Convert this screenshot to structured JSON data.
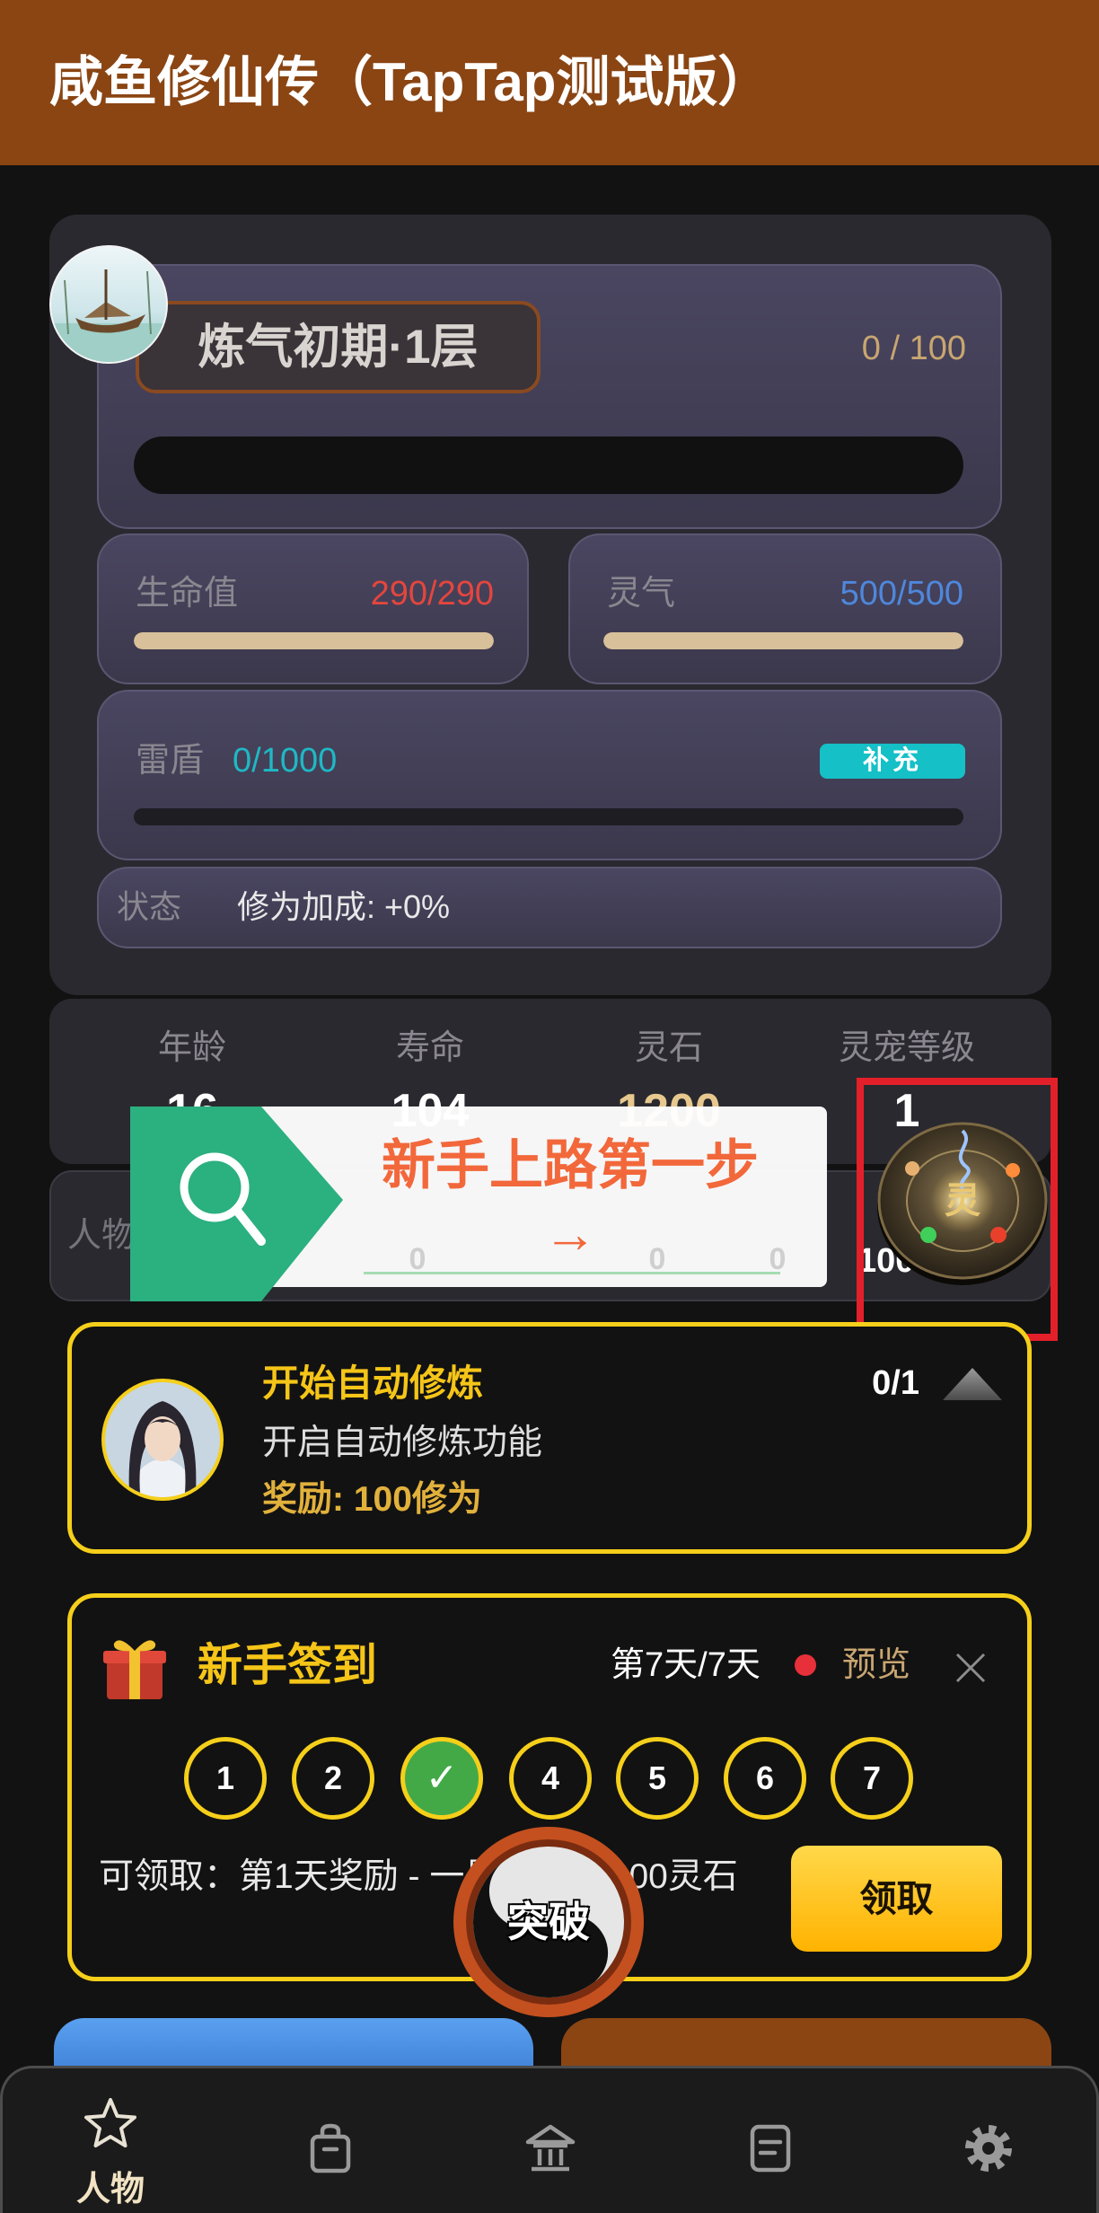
{
  "app": {
    "title": "咸鱼修仙传（TapTap测试版）"
  },
  "colors": {
    "header": "#8a4513",
    "accent": "#f5cf1a",
    "hp": "#e4463e",
    "qi": "#4f87db",
    "shield": "#1fb8c5",
    "tutorial": "#f2683b",
    "highlight": "#e3202a"
  },
  "realm": {
    "name": "炼气初期·1层",
    "progress_text": "0 / 100",
    "progress": 0
  },
  "hp": {
    "label": "生命值",
    "value": "290/290",
    "fill": 1
  },
  "qi": {
    "label": "灵气",
    "value": "500/500",
    "fill": 1
  },
  "shield": {
    "label": "雷盾",
    "value": "0/1000",
    "fill": 0,
    "button": "补充"
  },
  "status": {
    "label": "状态",
    "text": "修为加成: +0%"
  },
  "stats": [
    {
      "label": "年龄",
      "value": "16"
    },
    {
      "label": "寿命",
      "value": "104"
    },
    {
      "label": "灵石",
      "value": "1200"
    },
    {
      "label": "灵宠等级",
      "value": "1"
    }
  ],
  "row2": {
    "label": "人物",
    "values": [
      "0",
      "0",
      "0"
    ],
    "right_value": "100"
  },
  "tutorial": {
    "title": "新手上路第一步",
    "arrow": "→",
    "icon": "search-icon"
  },
  "pet_disc": {
    "glyph": "灵"
  },
  "task": {
    "title": "开始自动修炼",
    "progress": "0/1",
    "description": "开启自动修炼功能",
    "reward": "奖励: 100修为"
  },
  "signin": {
    "title": "新手签到",
    "day_progress": "第7天/7天",
    "preview": "预览",
    "days": [
      {
        "label": "1",
        "claimed": false
      },
      {
        "label": "2",
        "claimed": false
      },
      {
        "label": "✓",
        "claimed": true
      },
      {
        "label": "4",
        "claimed": false
      },
      {
        "label": "5",
        "claimed": false
      },
      {
        "label": "6",
        "claimed": false
      },
      {
        "label": "7",
        "claimed": false
      }
    ],
    "claim_text": "可领取：第1天奖励 - 一星飞剑 + 600灵石",
    "claim_button": "领取"
  },
  "breakthrough": {
    "label": "突破"
  },
  "nav": [
    {
      "icon": "star-icon",
      "label": "人物",
      "active": true
    },
    {
      "icon": "bag-icon",
      "active": false
    },
    {
      "icon": "home-icon",
      "active": false
    },
    {
      "icon": "document-icon",
      "active": false
    },
    {
      "icon": "gear-icon",
      "active": false
    }
  ]
}
